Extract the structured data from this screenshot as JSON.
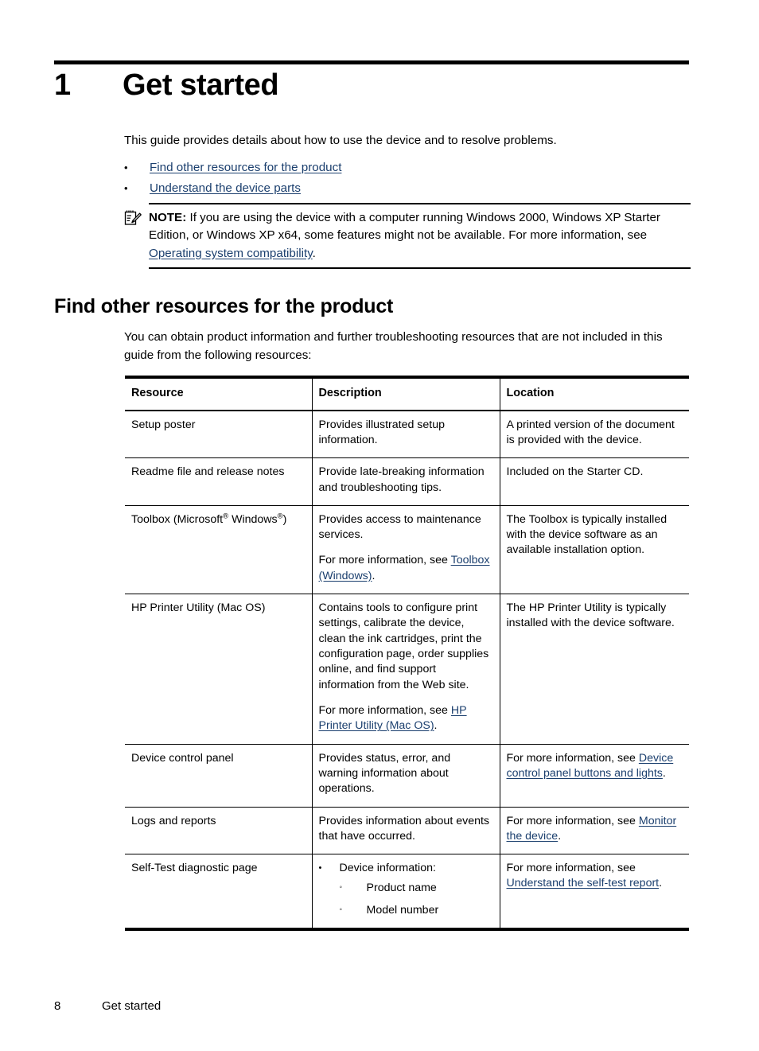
{
  "chapter": {
    "number": "1",
    "title": "Get started"
  },
  "intro": {
    "text": "This guide provides details about how to use the device and to resolve problems."
  },
  "toc": {
    "bullet": "•",
    "items": [
      {
        "label": "Find other resources for the product"
      },
      {
        "label": "Understand the device parts"
      }
    ]
  },
  "note": {
    "icon": "note-pencil-icon",
    "label": "NOTE:",
    "text_before": "If you are using the device with a computer running Windows 2000, Windows XP Starter Edition, or Windows XP x64, some features might not be available. For more information, see ",
    "link": "Operating system compatibility",
    "text_after": "."
  },
  "section": {
    "heading": "Find other resources for the product",
    "intro": "You can obtain product information and further troubleshooting resources that are not included in this guide from the following resources:"
  },
  "table": {
    "headers": [
      "Resource",
      "Description",
      "Location"
    ],
    "rows": [
      {
        "resource": "Setup poster",
        "description": [
          "Provides illustrated setup information."
        ],
        "location": [
          "A printed version of the document is provided with the device."
        ]
      },
      {
        "resource": "Readme file and release notes",
        "description": [
          "Provide late-breaking information and troubleshooting tips."
        ],
        "location": [
          "Included on the Starter CD."
        ]
      },
      {
        "resource": "Toolbox (Microsoft® Windows®)",
        "resource_parts": {
          "a": "Toolbox (Microsoft",
          "sup1": "®",
          "b": " Windows",
          "sup2": "®",
          "c": ")"
        },
        "description": [
          "Provides access to maintenance services."
        ],
        "description_link_intro": "For more information, see ",
        "description_link": "Toolbox (Windows)",
        "description_link_after": ".",
        "location": [
          "The Toolbox is typically installed with the device software as an available installation option."
        ]
      },
      {
        "resource": "HP Printer Utility (Mac OS)",
        "description": [
          "Contains tools to configure print settings, calibrate the device, clean the ink cartridges, print the configuration page, order supplies online, and find support information from the Web site."
        ],
        "description_link_intro": "For more information, see ",
        "description_link": "HP Printer Utility (Mac OS)",
        "description_link_after": ".",
        "location": [
          "The HP Printer Utility is typically installed with the device software."
        ]
      },
      {
        "resource": "Device control panel",
        "description": [
          "Provides status, error, and warning information about operations."
        ],
        "location_intro": "For more information, see ",
        "location_link": "Device control panel buttons and lights",
        "location_after": "."
      },
      {
        "resource": "Logs and reports",
        "description": [
          "Provides information about events that have occurred."
        ],
        "location_intro": "For more information, see ",
        "location_link": "Monitor the device",
        "location_after": "."
      },
      {
        "resource": "Self-Test diagnostic page",
        "description_list": {
          "bullet": "•",
          "sub_bullet": "◦",
          "item": "Device information:",
          "sub_items": [
            "Product name",
            "Model number"
          ]
        },
        "location_intro": "For more information, see ",
        "location_link": "Understand the self-test report",
        "location_after": "."
      }
    ]
  },
  "footer": {
    "page_number": "8",
    "label": "Get started"
  },
  "colors": {
    "link": "#1b3f6e",
    "text": "#000000",
    "rule": "#000000",
    "background": "#ffffff"
  }
}
